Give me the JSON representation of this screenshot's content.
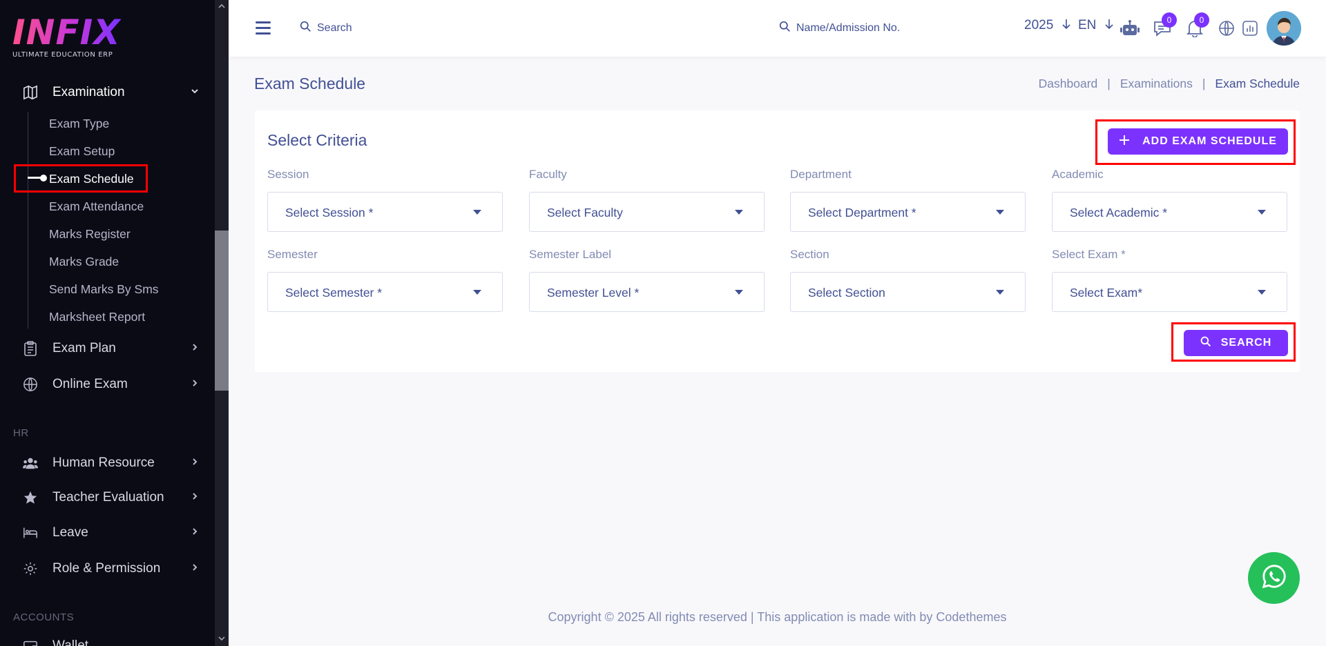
{
  "sidebar": {
    "logo_text": "INFIX",
    "logo_subtitle": "ULTIMATE EDUCATION ERP",
    "examination": {
      "label": "Examination"
    },
    "sub_items": [
      {
        "label": "Exam Type"
      },
      {
        "label": "Exam Setup"
      },
      {
        "label": "Exam Schedule"
      },
      {
        "label": "Exam Attendance"
      },
      {
        "label": "Marks Register"
      },
      {
        "label": "Marks Grade"
      },
      {
        "label": "Send Marks By Sms"
      },
      {
        "label": "Marksheet Report"
      }
    ],
    "exam_plan": {
      "label": "Exam Plan"
    },
    "online_exam": {
      "label": "Online Exam"
    },
    "hr_section": "HR",
    "human_resource": {
      "label": "Human Resource"
    },
    "teacher_evaluation": {
      "label": "Teacher Evaluation"
    },
    "leave": {
      "label": "Leave"
    },
    "role_permission": {
      "label": "Role & Permission"
    },
    "accounts_section": "ACCOUNTS",
    "wallet": {
      "label": "Wallet"
    }
  },
  "header": {
    "search_label": "Search",
    "student_search_label": "Name/Admission No.",
    "year": "2025",
    "language": "EN",
    "messages_count": "0",
    "notifications_count": "0"
  },
  "page": {
    "title": "Exam Schedule",
    "breadcrumb": [
      "Dashboard",
      "Examinations",
      "Exam Schedule"
    ]
  },
  "criteria": {
    "title": "Select Criteria",
    "add_button": "ADD EXAM SCHEDULE",
    "search_button": "SEARCH",
    "fields": [
      {
        "label": "Session",
        "value": "Select Session *"
      },
      {
        "label": "Faculty",
        "value": "Select Faculty"
      },
      {
        "label": "Department",
        "value": "Select Department *"
      },
      {
        "label": "Academic",
        "value": "Select Academic *"
      },
      {
        "label": "Semester",
        "value": "Select Semester *"
      },
      {
        "label": "Semester Label",
        "value": "Semester Level *"
      },
      {
        "label": "Section",
        "value": "Select Section"
      },
      {
        "label": "Select Exam *",
        "value": "Select Exam*"
      }
    ]
  },
  "footer": {
    "text": "Copyright © 2025 All rights reserved | This application is made with by Codethemes"
  },
  "colors": {
    "accent": "#7c32ff",
    "text": "#415094",
    "sidebar_bg": "#0b0b16",
    "highlight": "#ff0000",
    "whatsapp": "#25c05a"
  }
}
